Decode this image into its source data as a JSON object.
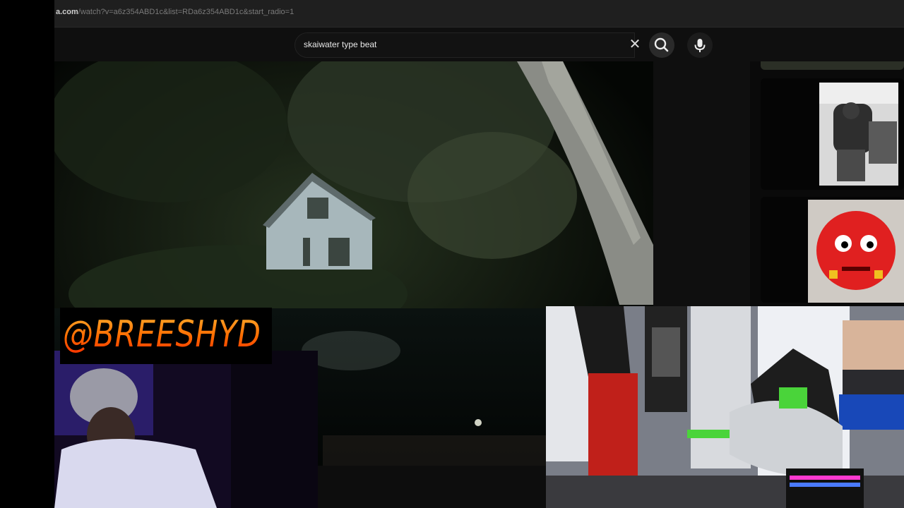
{
  "browser": {
    "url_domain": "a.com",
    "url_path": "/watch?v=a6z354ABD1c&list=RDa6z354ABD1c&start_radio=1"
  },
  "search": {
    "query": "skaiwater type beat",
    "clear_glyph": "✕"
  },
  "overlay": {
    "handle": "@BREESHYD"
  },
  "icons": {
    "clear": "close-icon",
    "search": "search-icon",
    "mic": "microphone-icon"
  },
  "colors": {
    "handle_gradient_top": "#ffb02e",
    "handle_gradient_bottom": "#ff2f00",
    "background": "#0f0f0f"
  }
}
